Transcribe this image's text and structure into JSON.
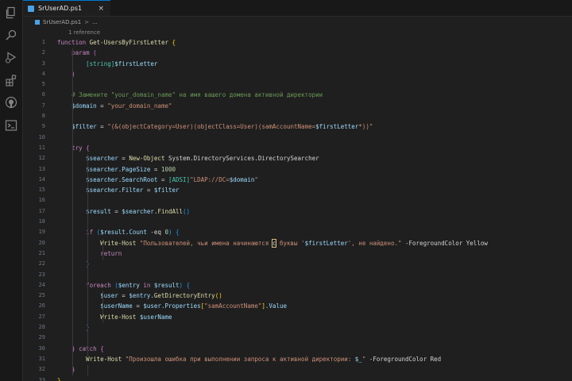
{
  "tab": {
    "label": "SrUserAD.ps1",
    "close": "×"
  },
  "breadcrumb": {
    "file": "SrUserAD.ps1",
    "sep": ">",
    "more": "..."
  },
  "codelens": "1 reference",
  "activity_icons": [
    "files-icon",
    "search-icon",
    "run-debug-icon",
    "extensions-icon",
    "github-icon",
    "terminal-icon"
  ],
  "lines": [
    [
      [
        "kw",
        "function "
      ],
      [
        "fn",
        "Get-UsersByFirstLetter "
      ],
      [
        "pn",
        "{"
      ]
    ],
    [
      [
        "t",
        "    "
      ],
      [
        "kw",
        "param "
      ],
      [
        "pn2",
        "("
      ]
    ],
    [
      [
        "t",
        "        "
      ],
      [
        "type",
        "[string]"
      ],
      [
        "var",
        "$firstLetter"
      ]
    ],
    [
      [
        "t",
        "    "
      ],
      [
        "pn2",
        ")"
      ]
    ],
    [],
    [
      [
        "t",
        "    "
      ],
      [
        "cm",
        "# Замените \"your_domain_name\" на имя вашего домена активной директории"
      ]
    ],
    [
      [
        "t",
        "    "
      ],
      [
        "var",
        "$domain"
      ],
      [
        "op",
        " = "
      ],
      [
        "str",
        "\"your_domain_name\""
      ]
    ],
    [],
    [
      [
        "t",
        "    "
      ],
      [
        "var",
        "$filter"
      ],
      [
        "op",
        " = "
      ],
      [
        "str",
        "\"(&(objectCategory=User)(objectClass=User)(samAccountName="
      ],
      [
        "var",
        "$firstLetter"
      ],
      [
        "str",
        "*))\""
      ]
    ],
    [],
    [
      [
        "t",
        "    "
      ],
      [
        "kw",
        "try "
      ],
      [
        "pn2",
        "{"
      ]
    ],
    [
      [
        "t",
        "        "
      ],
      [
        "var",
        "$searcher"
      ],
      [
        "op",
        " = "
      ],
      [
        "fn",
        "New-Object "
      ],
      [
        "op",
        "System.DirectoryServices.DirectorySearcher"
      ]
    ],
    [
      [
        "t",
        "        "
      ],
      [
        "var",
        "$searcher"
      ],
      [
        "op",
        "."
      ],
      [
        "var",
        "PageSize"
      ],
      [
        "op",
        " = "
      ],
      [
        "num",
        "1000"
      ]
    ],
    [
      [
        "t",
        "        "
      ],
      [
        "var",
        "$searcher"
      ],
      [
        "op",
        "."
      ],
      [
        "var",
        "SearchRoot"
      ],
      [
        "op",
        " = "
      ],
      [
        "type",
        "[ADSI]"
      ],
      [
        "str",
        "\"LDAP://DC="
      ],
      [
        "var",
        "$domain"
      ],
      [
        "str",
        "\""
      ]
    ],
    [
      [
        "t",
        "        "
      ],
      [
        "var",
        "$searcher"
      ],
      [
        "op",
        "."
      ],
      [
        "var",
        "Filter"
      ],
      [
        "op",
        " = "
      ],
      [
        "var",
        "$filter"
      ]
    ],
    [],
    [
      [
        "t",
        "        "
      ],
      [
        "var",
        "$result"
      ],
      [
        "op",
        " = "
      ],
      [
        "var",
        "$searcher"
      ],
      [
        "op",
        "."
      ],
      [
        "fn",
        "FindAll"
      ],
      [
        "pn3",
        "()"
      ]
    ],
    [],
    [
      [
        "t",
        "        "
      ],
      [
        "kw",
        "if "
      ],
      [
        "pn3",
        "("
      ],
      [
        "var",
        "$result"
      ],
      [
        "op",
        "."
      ],
      [
        "var",
        "Count"
      ],
      [
        "op",
        " -eq "
      ],
      [
        "num",
        "0"
      ],
      [
        "pn3",
        ")"
      ],
      [
        "op",
        " "
      ],
      [
        "pn3",
        "{"
      ]
    ],
    [
      [
        "t",
        "            "
      ],
      [
        "fn",
        "Write-Host "
      ],
      [
        "str",
        "\"Пользователей, чьи имена начинаются "
      ],
      [
        "hl",
        "с"
      ],
      [
        "str",
        " буквы '"
      ],
      [
        "var",
        "$firstLetter"
      ],
      [
        "str",
        "', не найдено.\""
      ],
      [
        "op",
        " -ForegroundColor Yellow"
      ]
    ],
    [
      [
        "t",
        "            "
      ],
      [
        "kw",
        "return"
      ]
    ],
    [
      [
        "t",
        "        "
      ],
      [
        "pn3",
        "}"
      ]
    ],
    [],
    [
      [
        "t",
        "        "
      ],
      [
        "kw",
        "foreach "
      ],
      [
        "pn3",
        "("
      ],
      [
        "var",
        "$entry"
      ],
      [
        "kw",
        " in "
      ],
      [
        "var",
        "$result"
      ],
      [
        "pn3",
        ")"
      ],
      [
        "op",
        " "
      ],
      [
        "pn3",
        "{"
      ]
    ],
    [
      [
        "t",
        "            "
      ],
      [
        "var",
        "$user"
      ],
      [
        "op",
        " = "
      ],
      [
        "var",
        "$entry"
      ],
      [
        "op",
        "."
      ],
      [
        "fn",
        "GetDirectoryEntry"
      ],
      [
        "pn",
        "()"
      ]
    ],
    [
      [
        "t",
        "            "
      ],
      [
        "var",
        "$userName"
      ],
      [
        "op",
        " = "
      ],
      [
        "var",
        "$user"
      ],
      [
        "op",
        "."
      ],
      [
        "var",
        "Properties"
      ],
      [
        "pn",
        "["
      ],
      [
        "str",
        "\"samAccountName\""
      ],
      [
        "pn",
        "]"
      ],
      [
        "op",
        "."
      ],
      [
        "var",
        "Value"
      ]
    ],
    [
      [
        "t",
        "            "
      ],
      [
        "fn",
        "Write-Host "
      ],
      [
        "var",
        "$userName"
      ]
    ],
    [
      [
        "t",
        "        "
      ],
      [
        "pn3",
        "}"
      ]
    ],
    [],
    [
      [
        "t",
        "    "
      ],
      [
        "pn2",
        "}"
      ],
      [
        "kw",
        " catch "
      ],
      [
        "pn2",
        "{"
      ]
    ],
    [
      [
        "t",
        "        "
      ],
      [
        "fn",
        "Write-Host "
      ],
      [
        "str",
        "\"Произошла ошибка при выполнении запроса к активной директории: "
      ],
      [
        "var",
        "$_"
      ],
      [
        "str",
        "\""
      ],
      [
        "op",
        " -ForegroundColor Red"
      ]
    ],
    [
      [
        "t",
        "    "
      ],
      [
        "pn2",
        "}"
      ]
    ],
    [
      [
        "pn",
        "}"
      ]
    ]
  ]
}
